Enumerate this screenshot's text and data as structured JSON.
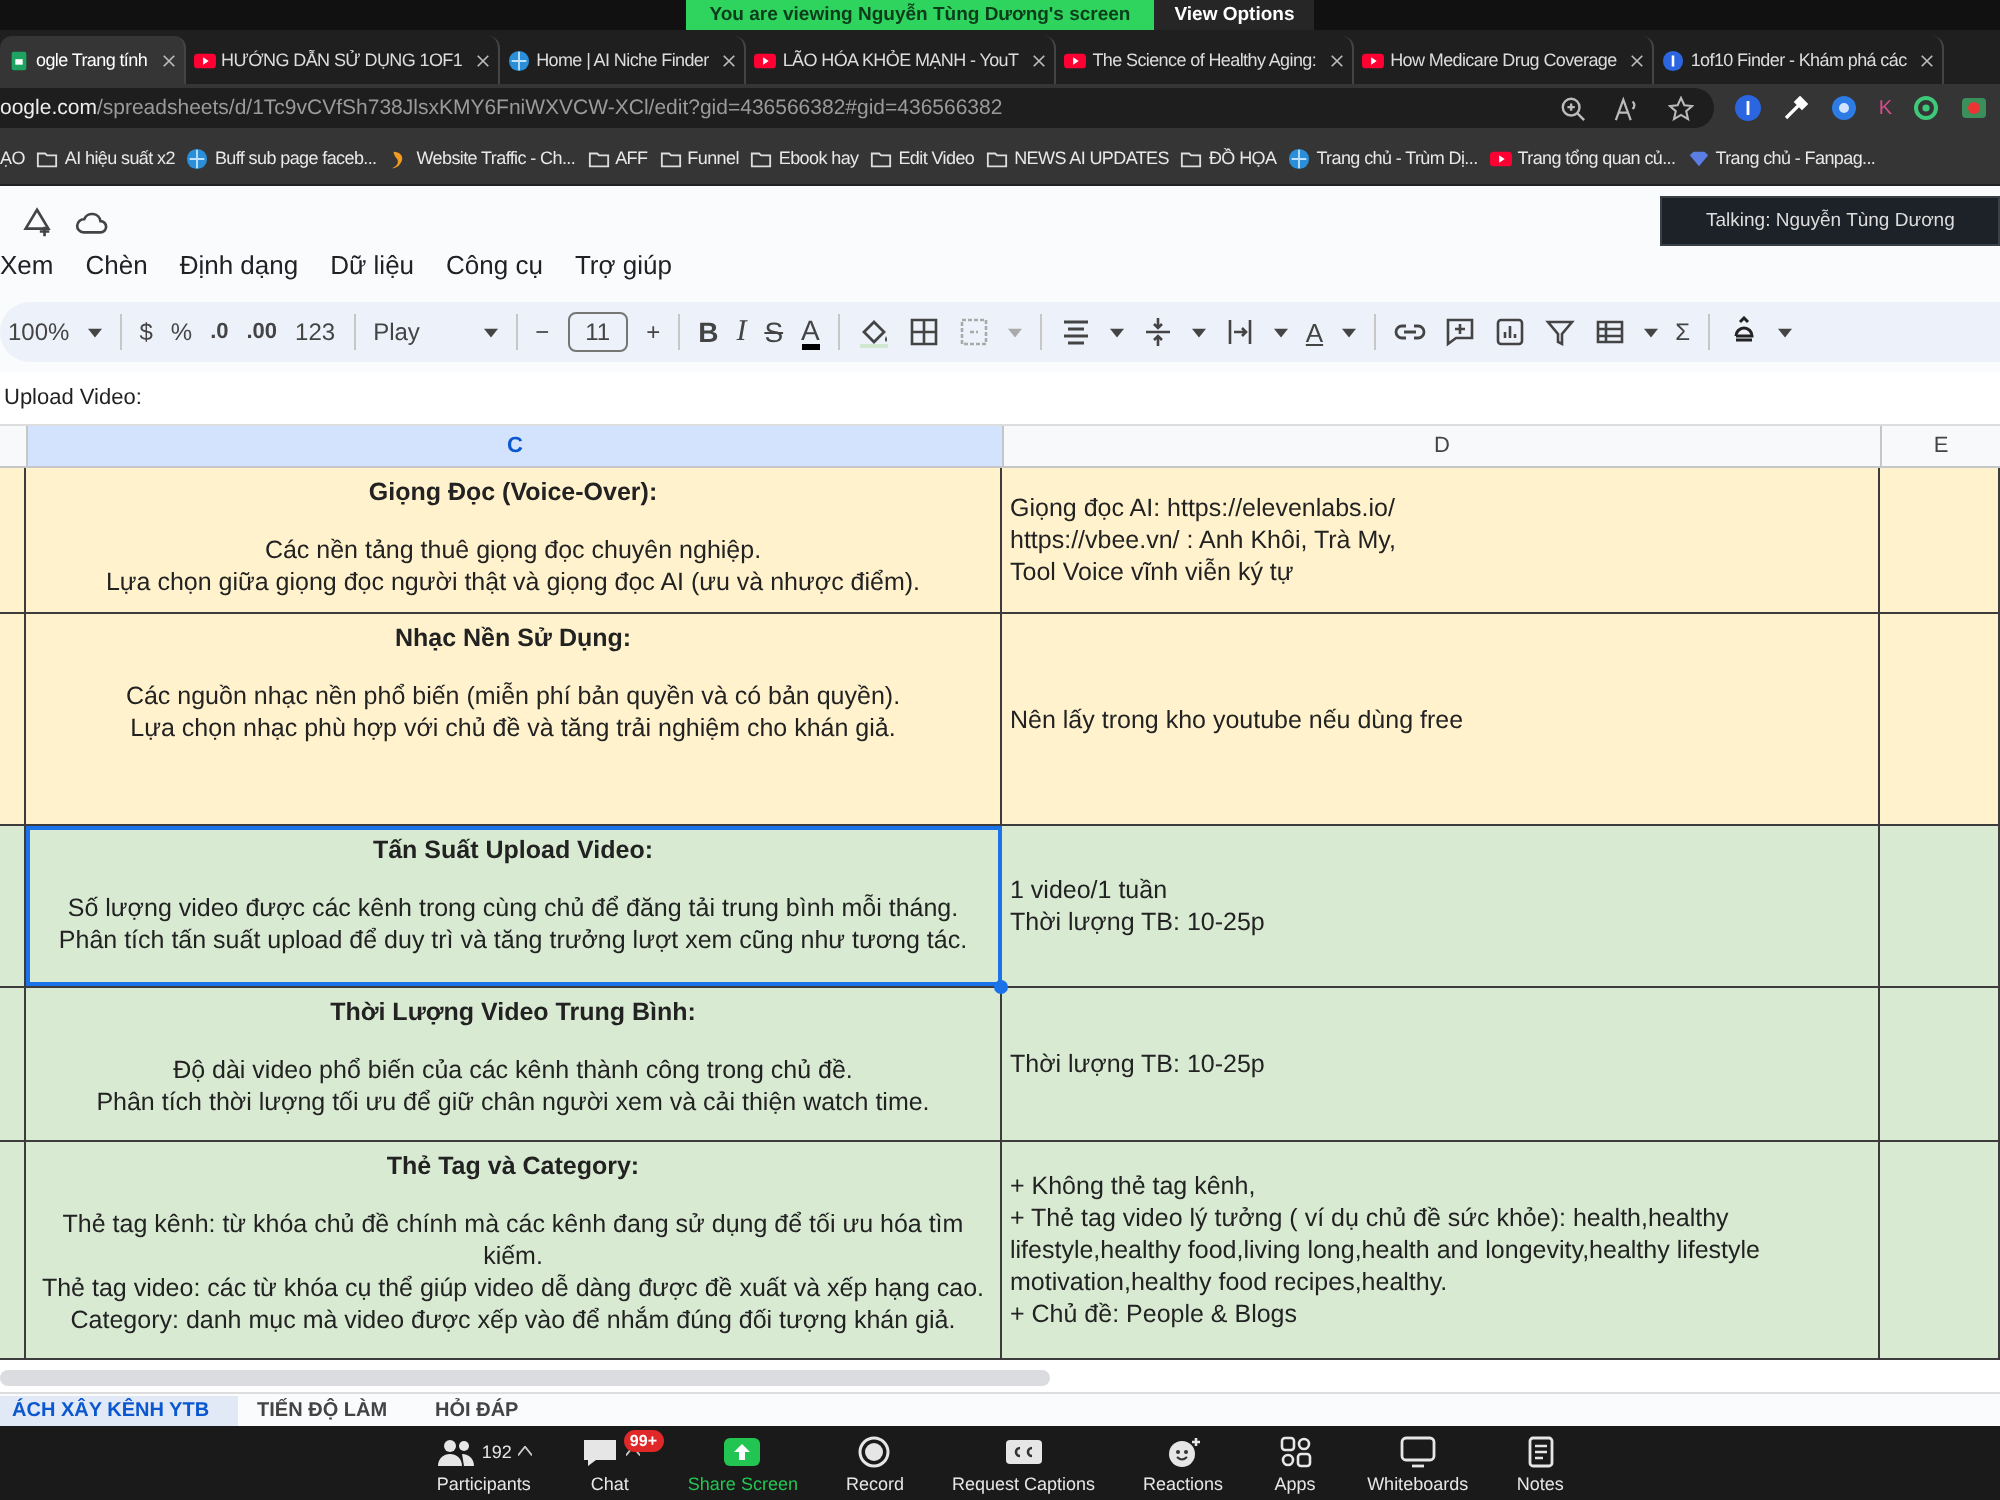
{
  "zoom_banner": {
    "text": "You are viewing Nguyễn Tùng Dương's screen",
    "view_options": "View Options"
  },
  "browser_tabs": [
    {
      "title": "ogle Trang tính",
      "kind": "sheets",
      "selected": true
    },
    {
      "title": "HƯỚNG DẪN SỬ DỤNG 1OF1",
      "kind": "video",
      "selected": false
    },
    {
      "title": "Home | AI Niche Finder",
      "kind": "web",
      "selected": false
    },
    {
      "title": "LÃO HÓA KHỎE MẠNH - YouT",
      "kind": "video",
      "selected": false
    },
    {
      "title": "The Science of Healthy Aging:",
      "kind": "video",
      "selected": false
    },
    {
      "title": "How Medicare Drug Coverage",
      "kind": "video",
      "selected": false
    },
    {
      "title": "1of10 Finder - Khám phá các",
      "kind": "app",
      "selected": false
    }
  ],
  "address_bar": {
    "host": "oogle.com",
    "path": "/spreadsheets/d/1Tc9vCVfSh738JlsxKMY6FniWXVCW-XCl/edit?gid=436566382#gid=436566382"
  },
  "extension_letter": "K",
  "bookmarks": [
    {
      "label": "ẠO",
      "kind": "plain"
    },
    {
      "label": "AI hiệu suất x2",
      "kind": "folder"
    },
    {
      "label": "Buff sub page faceb...",
      "kind": "web"
    },
    {
      "label": "Website Traffic - Ch...",
      "kind": "analytics"
    },
    {
      "label": "AFF",
      "kind": "folder"
    },
    {
      "label": "Funnel",
      "kind": "folder"
    },
    {
      "label": "Ebook hay",
      "kind": "folder"
    },
    {
      "label": "Edit Video",
      "kind": "folder"
    },
    {
      "label": "NEWS AI UPDATES",
      "kind": "folder"
    },
    {
      "label": "ĐỒ HỌA",
      "kind": "folder"
    },
    {
      "label": "Trang chủ - Trùm Dị...",
      "kind": "web"
    },
    {
      "label": "Trang tổng quan củ...",
      "kind": "video"
    },
    {
      "label": "Trang chủ - Fanpag...",
      "kind": "fanpage"
    }
  ],
  "talking_indicator": "Talking: Nguyễn Tùng Dương",
  "menu": [
    "Xem",
    "Chèn",
    "Định dạng",
    "Dữ liệu",
    "Công cụ",
    "Trợ giúp"
  ],
  "toolbar": {
    "zoom": "100%",
    "currency": "$",
    "percent": "%",
    "decimal_decrease": ".0",
    "decimal_increase": ".00",
    "number_format": "123",
    "font": "Play",
    "size_down": "−",
    "font_size": "11",
    "size_up": "+",
    "bold": "B",
    "italic": "I",
    "strikethrough": "S",
    "text_color": "A",
    "rotation": "A",
    "functions": "Σ"
  },
  "formula_bar": "Upload Video:",
  "columns": [
    {
      "label": "C",
      "selected": true
    },
    {
      "label": "D",
      "selected": false
    },
    {
      "label": "E",
      "selected": false
    }
  ],
  "rows": [
    {
      "color": "#fff2cc",
      "selected": false,
      "title": "Giọng Đọc (Voice-Over):",
      "lines": [
        "Các nền tảng thuê giọng đọc chuyên nghiệp.",
        "Lựa chọn giữa giọng đọc người thật và giọng đọc AI (ưu và nhược điểm)."
      ],
      "notes": [
        "Giọng đọc AI: https://elevenlabs.io/",
        "https://vbee.vn/ : Anh Khôi, Trà My,",
        "Tool Voice vĩnh viễn ký tự"
      ]
    },
    {
      "color": "#fff2cc",
      "selected": false,
      "title": "Nhạc Nền Sử Dụng:",
      "lines": [
        "Các nguồn nhạc nền phổ biến (miễn phí bản quyền và có bản quyền).",
        "Lựa chọn nhạc phù hợp với chủ đề và tăng trải nghiệm cho khán giả."
      ],
      "notes": [
        "Nên lấy trong kho youtube nếu dùng free"
      ]
    },
    {
      "color": "#d9ead3",
      "selected": true,
      "title": "Tấn Suất Upload Video:",
      "lines": [
        "Số lượng video được các kênh trong cùng chủ để đăng tải trung bình mỗi tháng.",
        "Phân tích tấn suất upload để duy trì và tăng trưởng lượt xem cũng như tương tác."
      ],
      "notes": [
        "1 video/1 tuần",
        "Thời lượng TB: 10-25p"
      ]
    },
    {
      "color": "#d9ead3",
      "selected": false,
      "title": "Thời Lượng Video Trung Bình:",
      "lines": [
        "Độ dài video phổ biến của các kênh thành công trong chủ đề.",
        "Phân tích thời lượng tối ưu để giữ chân người xem và cải thiện watch time."
      ],
      "notes": [
        "Thời lượng TB: 10-25p"
      ]
    },
    {
      "color": "#d9ead3",
      "selected": false,
      "title": "Thẻ Tag và Category:",
      "lines": [
        "Thẻ tag kênh: từ khóa chủ đề chính mà các kênh đang sử dụng để tối ưu hóa tìm kiếm.",
        "Thẻ tag video: các từ khóa cụ thể giúp video dễ dàng được đề xuất và xếp hạng cao.",
        "Category: danh mục mà video được xếp vào để nhắm đúng đối tượng khán giả."
      ],
      "notes": [
        "+ Không thẻ tag kênh,",
        "+ Thẻ tag video lý tưởng ( ví dụ chủ đề sức khỏe): health,healthy lifestyle,healthy food,living long,health and longevity,healthy lifestyle motivation,healthy food recipes,healthy.",
        "+ Chủ đề: People & Blogs"
      ]
    }
  ],
  "sheet_tabs": [
    {
      "label": "ÁCH XÂY KÊNH YTB",
      "selected": true
    },
    {
      "label": "TIẾN ĐỘ LÀM",
      "selected": false
    },
    {
      "label": "HỎI ĐÁP",
      "selected": false
    }
  ],
  "meeting_controls": [
    {
      "kind": "participants",
      "label": "Participants",
      "count": "192"
    },
    {
      "kind": "chat",
      "label": "Chat",
      "badge": "99+"
    },
    {
      "kind": "share",
      "label": "Share Screen"
    },
    {
      "kind": "record",
      "label": "Record"
    },
    {
      "kind": "captions",
      "label": "Request Captions"
    },
    {
      "kind": "reactions",
      "label": "Reactions"
    },
    {
      "kind": "apps",
      "label": "Apps"
    },
    {
      "kind": "whiteboards",
      "label": "Whiteboards"
    },
    {
      "kind": "notes",
      "label": "Notes"
    }
  ]
}
